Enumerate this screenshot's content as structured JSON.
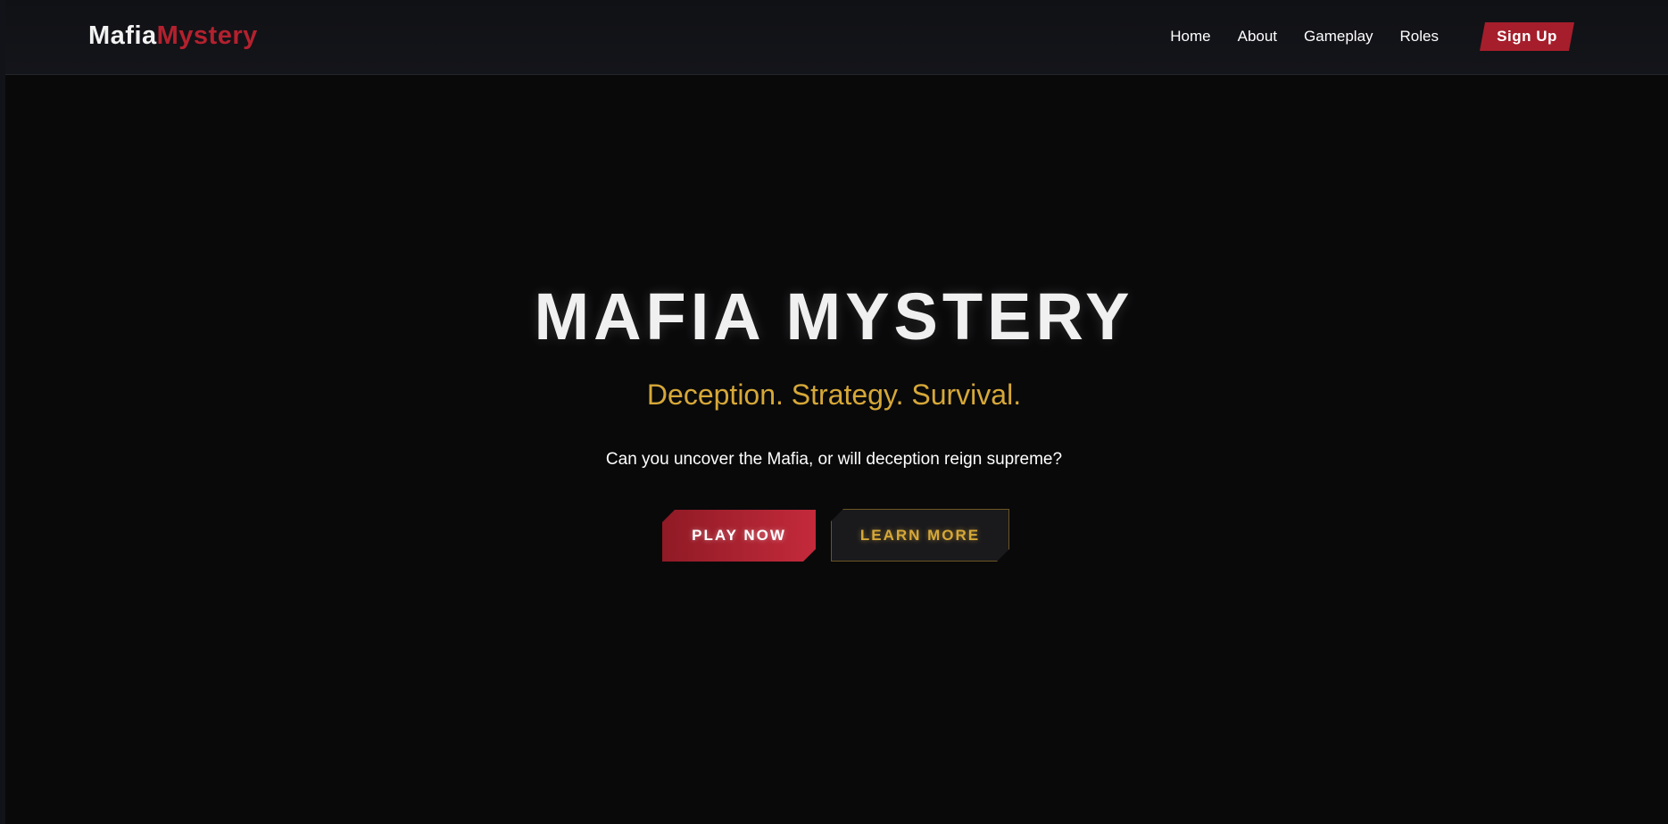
{
  "navbar": {
    "logo": {
      "part_a": "Mafia",
      "part_b": "Mystery"
    },
    "links": [
      "Home",
      "About",
      "Gameplay",
      "Roles"
    ],
    "signup_label": "Sign Up"
  },
  "hero": {
    "title": "MAFIA MYSTERY",
    "tagline": "Deception. Strategy. Survival.",
    "description": "Can you uncover the Mafia, or will deception reign supreme?",
    "play_label": "PLAY NOW",
    "learn_label": "LEARN MORE"
  },
  "colors": {
    "background": "#09090a",
    "accent_red": "#b3212e",
    "accent_gold": "#d6a838"
  }
}
